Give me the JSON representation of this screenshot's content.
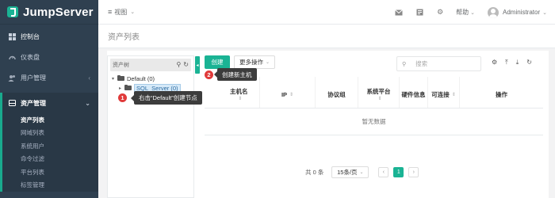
{
  "brand": {
    "name": "JumpServer",
    "logo_color": "#1ab394"
  },
  "sidebar": {
    "items": [
      {
        "label": "控制台",
        "icon": "dashboard-icon"
      },
      {
        "label": "仪表盘",
        "icon": "gauge-icon"
      },
      {
        "label": "用户管理",
        "icon": "users-icon"
      }
    ],
    "active_group": {
      "label": "资产管理",
      "icon": "inbox-icon"
    },
    "sub_items": [
      {
        "label": "资产列表",
        "active": true
      },
      {
        "label": "网域列表"
      },
      {
        "label": "系统用户"
      },
      {
        "label": "命令过滤"
      },
      {
        "label": "平台列表"
      },
      {
        "label": "标签管理"
      }
    ]
  },
  "topbar": {
    "view_label": "视图",
    "help_label": "帮助",
    "user_name": "Administrator",
    "icons": [
      "mail-icon",
      "card-icon",
      "gear-icon"
    ]
  },
  "page": {
    "title": "资产列表"
  },
  "tree": {
    "search_placeholder": "资产树",
    "nodes": [
      {
        "label": "Default (0)",
        "level": 0
      },
      {
        "label": "SQL_Server (0)",
        "level": 1,
        "selected": true
      }
    ]
  },
  "toolbar": {
    "create_label": "创建",
    "more_label": "更多操作",
    "search_placeholder": "搜索"
  },
  "table": {
    "columns": [
      "主机名",
      "IP",
      "协议组",
      "系统平台",
      "硬件信息",
      "可连接",
      "操作"
    ],
    "empty_text": "暂无数据"
  },
  "pager": {
    "total_text": "共 0 条",
    "page_size": "15条/页",
    "current_page": "1"
  },
  "annotations": [
    {
      "number": "1",
      "text": "右击“Default”创建节点"
    },
    {
      "number": "2",
      "text": "创建新主机"
    }
  ],
  "colors": {
    "accent": "#1ab394",
    "sidebar_bg": "#2f4050",
    "badge_red": "#e03a3a"
  }
}
